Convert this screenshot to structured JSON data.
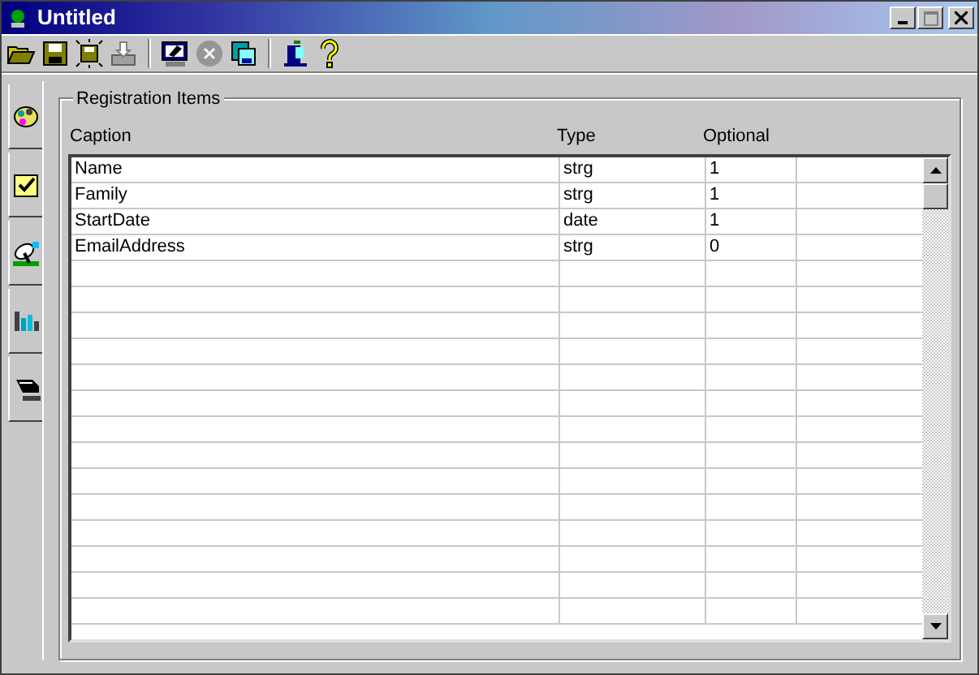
{
  "window": {
    "title": "Untitled"
  },
  "toolbar": [
    {
      "kind": "open",
      "disabled": false
    },
    {
      "kind": "save",
      "disabled": false
    },
    {
      "kind": "save-all",
      "disabled": false
    },
    {
      "kind": "tray",
      "disabled": false
    },
    {
      "kind": "separator"
    },
    {
      "kind": "monitor",
      "disabled": false
    },
    {
      "kind": "cancel",
      "disabled": true
    },
    {
      "kind": "copy",
      "disabled": false
    },
    {
      "kind": "separator"
    },
    {
      "kind": "exit",
      "disabled": false
    },
    {
      "kind": "help",
      "disabled": false
    }
  ],
  "side_tabs": [
    {
      "kind": "palette",
      "selected": false
    },
    {
      "kind": "check",
      "selected": false
    },
    {
      "kind": "dish",
      "selected": false
    },
    {
      "kind": "chart",
      "selected": false
    },
    {
      "kind": "pen",
      "selected": true
    }
  ],
  "group": {
    "title": "Registration Items"
  },
  "table": {
    "columns": [
      "Caption",
      "Type",
      "Optional"
    ],
    "rows": [
      [
        "Name",
        "strg",
        "1"
      ],
      [
        "Family",
        "strg",
        "1"
      ],
      [
        "StartDate",
        "date",
        "1"
      ],
      [
        "EmailAddress",
        "strg",
        "0"
      ]
    ]
  }
}
